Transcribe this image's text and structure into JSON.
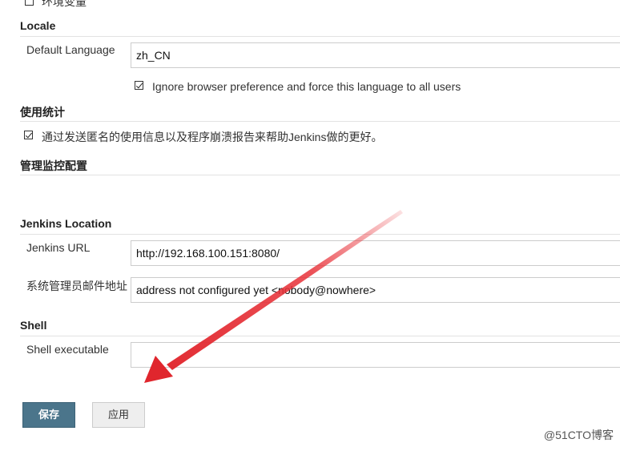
{
  "env_vars": {
    "label": "环境变量",
    "checked": false
  },
  "locale": {
    "title": "Locale",
    "default_language_label": "Default Language",
    "default_language_value": "zh_CN",
    "ignore_browser_label": "Ignore browser preference and force this language to all users",
    "ignore_browser_checked": true
  },
  "usage_stats": {
    "title": "使用统计",
    "label": "通过发送匿名的使用信息以及程序崩溃报告来帮助Jenkins做的更好。",
    "checked": true
  },
  "admin_monitors": {
    "title": "管理监控配置"
  },
  "jenkins_location": {
    "title": "Jenkins Location",
    "url_label": "Jenkins URL",
    "url_value": "http://192.168.100.151:8080/",
    "admin_email_label": "系统管理员邮件地址",
    "admin_email_value": "address not configured yet <nobody@nowhere>"
  },
  "shell": {
    "title": "Shell",
    "executable_label": "Shell executable",
    "executable_value": ""
  },
  "buttons": {
    "save": "保存",
    "apply": "应用"
  },
  "watermark": "@51CTO博客",
  "colors": {
    "primary_button": "#4b758b",
    "annotation_arrow": "#e8333a"
  }
}
